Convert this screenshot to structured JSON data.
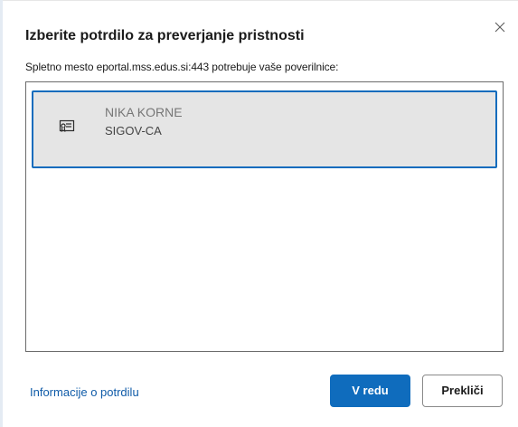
{
  "dialog": {
    "title": "Izberite potrdilo za preverjanje pristnosti",
    "subtitle": "Spletno mesto eportal.mss.edus.si:443 potrebuje vaše poverilnice:",
    "close_icon": "close-icon"
  },
  "certificates": [
    {
      "name": "NIKA KORNE",
      "issuer": "SIGOV-CA",
      "icon": "certificate-icon",
      "selected": true
    }
  ],
  "footer": {
    "info_link": "Informacije o potrdilu",
    "ok_label": "V redu",
    "cancel_label": "Prekliči"
  },
  "colors": {
    "accent": "#0f6cbd",
    "selected_bg": "#e5e5e5",
    "link": "#0f5ba8"
  }
}
